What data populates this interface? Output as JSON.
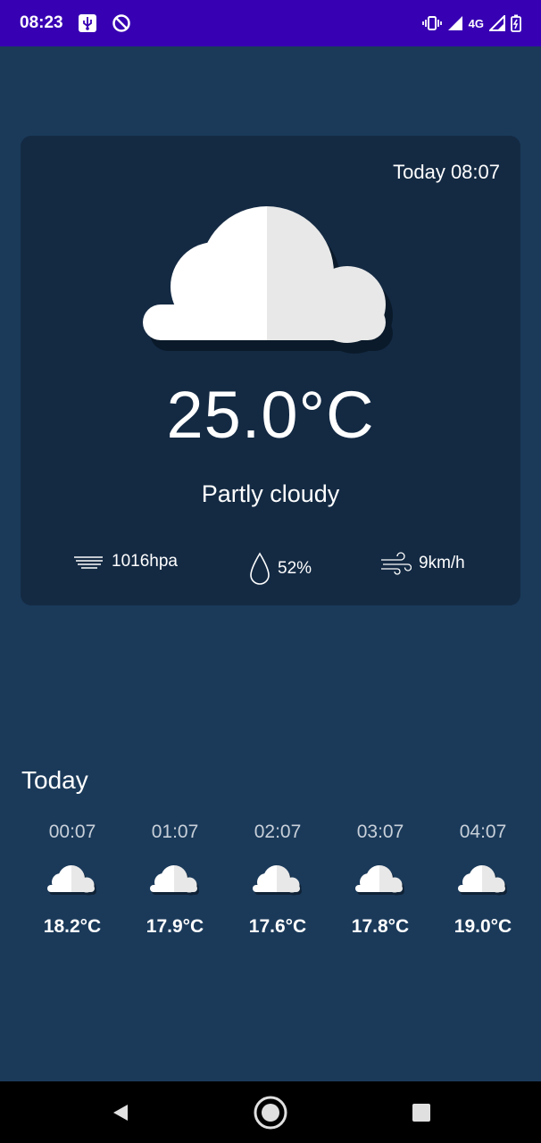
{
  "status_bar": {
    "time": "08:23",
    "network": "4G",
    "icons": [
      "usb-icon",
      "dnd-icon",
      "vibrate-icon",
      "signal-icon",
      "signal-icon",
      "battery-icon"
    ]
  },
  "current": {
    "date_label": "Today 08:07",
    "temperature": "25.0°C",
    "description": "Partly cloudy",
    "icon": "partly-cloudy-icon",
    "pressure": "1016hpa",
    "humidity": "52%",
    "wind": "9km/h"
  },
  "today": {
    "title": "Today",
    "hours": [
      {
        "time": "00:07",
        "temp": "18.2°C",
        "icon": "cloud-icon"
      },
      {
        "time": "01:07",
        "temp": "17.9°C",
        "icon": "cloud-icon"
      },
      {
        "time": "02:07",
        "temp": "17.6°C",
        "icon": "cloud-icon"
      },
      {
        "time": "03:07",
        "temp": "17.8°C",
        "icon": "cloud-icon"
      },
      {
        "time": "04:07",
        "temp": "19.0°C",
        "icon": "cloud-icon"
      }
    ]
  },
  "colors": {
    "background": "#1b3a5a",
    "card": "#142a43",
    "status_bar": "#3700b3",
    "cloud_light": "#ffffff",
    "cloud_shade": "#e8e8e8"
  }
}
